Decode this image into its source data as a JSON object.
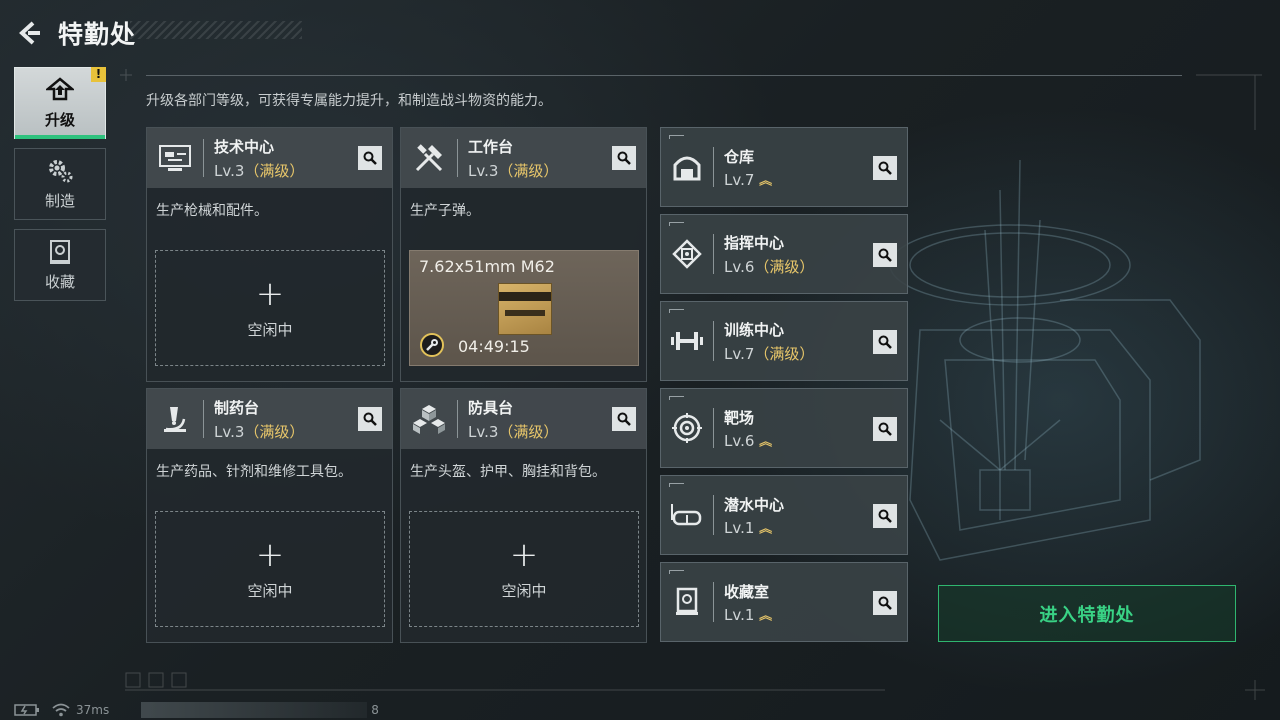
{
  "header": {
    "title": "特勤处"
  },
  "sidenav": {
    "items": [
      {
        "label": "升级",
        "icon": "upgrade-icon",
        "active": true,
        "badge": "!"
      },
      {
        "label": "制造",
        "icon": "gear-icon",
        "active": false
      },
      {
        "label": "收藏",
        "icon": "collection-icon",
        "active": false
      }
    ]
  },
  "description": "升级各部门等级，可获得专属能力提升，和制造战斗物资的能力。",
  "cards": [
    {
      "name": "技术中心",
      "level": "Lv.3",
      "maxed": "（满级）",
      "desc": "生产枪械和配件。",
      "slot_label": "空闲中",
      "slot_symbol": "+",
      "icon": "tech-center-icon"
    },
    {
      "name": "工作台",
      "level": "Lv.3",
      "maxed": "（满级）",
      "desc": "生产子弹。",
      "icon": "workbench-tools-icon",
      "production": {
        "item": "7.62x51mm M62",
        "timer": "04:49:15"
      }
    },
    {
      "name": "制药台",
      "level": "Lv.3",
      "maxed": "（满级）",
      "desc": "生产药品、针剂和维修工具包。",
      "slot_label": "空闲中",
      "slot_symbol": "+",
      "icon": "microscope-icon"
    },
    {
      "name": "防具台",
      "level": "Lv.3",
      "maxed": "（满级）",
      "desc": "生产头盔、护甲、胸挂和背包。",
      "slot_label": "空闲中",
      "slot_symbol": "+",
      "icon": "armor-cubes-icon"
    }
  ],
  "facilities": [
    {
      "name": "仓库",
      "level": "Lv.7",
      "upgradable": true,
      "maxed": "",
      "icon": "warehouse-icon"
    },
    {
      "name": "指挥中心",
      "level": "Lv.6",
      "upgradable": false,
      "maxed": "（满级）",
      "icon": "chip-icon"
    },
    {
      "name": "训练中心",
      "level": "Lv.7",
      "upgradable": false,
      "maxed": "（满级）",
      "icon": "dumbbell-icon"
    },
    {
      "name": "靶场",
      "level": "Lv.6",
      "upgradable": true,
      "maxed": "",
      "icon": "target-icon"
    },
    {
      "name": "潜水中心",
      "level": "Lv.1",
      "upgradable": true,
      "maxed": "",
      "icon": "diving-mask-icon"
    },
    {
      "name": "收藏室",
      "level": "Lv.1",
      "upgradable": true,
      "maxed": "",
      "icon": "collection-room-icon"
    }
  ],
  "enter_button": "进入特勤处",
  "status": {
    "ping": "37ms",
    "trailing": "8"
  },
  "colors": {
    "accent_green": "#39d285",
    "maxed_gold": "#e7c66a",
    "badge_yellow": "#e8c23a"
  }
}
